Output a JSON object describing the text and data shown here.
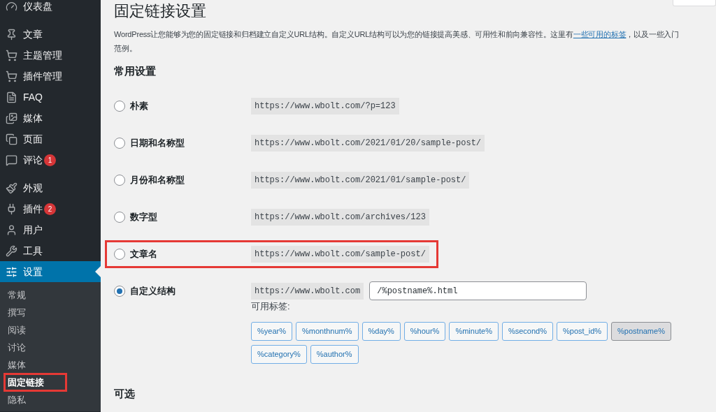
{
  "sidebar": {
    "items": [
      {
        "label": "仪表盘",
        "selected": false
      },
      {
        "label": "文章",
        "selected": false
      },
      {
        "label": "主题管理",
        "selected": false
      },
      {
        "label": "插件管理",
        "selected": false
      },
      {
        "label": "FAQ",
        "selected": false
      },
      {
        "label": "媒体",
        "selected": false
      },
      {
        "label": "页面",
        "selected": false
      },
      {
        "label": "评论",
        "selected": false,
        "badge": "1"
      },
      {
        "label": "外观",
        "selected": false
      },
      {
        "label": "插件",
        "selected": false,
        "badge": "2"
      },
      {
        "label": "用户",
        "selected": false
      },
      {
        "label": "工具",
        "selected": false
      },
      {
        "label": "设置",
        "selected": true,
        "submenu": [
          {
            "label": "常规",
            "selected": false,
            "highlighted": false
          },
          {
            "label": "撰写",
            "selected": false,
            "highlighted": false
          },
          {
            "label": "阅读",
            "selected": false,
            "highlighted": false
          },
          {
            "label": "讨论",
            "selected": false,
            "highlighted": false
          },
          {
            "label": "媒体",
            "selected": false,
            "highlighted": false
          },
          {
            "label": "固定链接",
            "selected": true,
            "highlighted": true
          },
          {
            "label": "隐私",
            "selected": false,
            "highlighted": false
          }
        ]
      }
    ]
  },
  "main": {
    "title": "固定链接设置",
    "intro": {
      "before": "WordPress让您能够为您的固定链接和归档建立自定义URL结构。自定义URL结构可以为您的链接提高美感、可用性和前向兼容性。这里有",
      "link": "一些可用的标签",
      "after": "，以及一些入门",
      "line2": "范例。"
    },
    "common_heading": "常用设置",
    "options": [
      {
        "kind": "preset",
        "label": "朴素",
        "url": "https://www.wbolt.com/?p=123",
        "selected": false,
        "highlighted": false
      },
      {
        "kind": "preset",
        "label": "日期和名称型",
        "url": "https://www.wbolt.com/2021/01/20/sample-post/",
        "selected": false,
        "highlighted": false
      },
      {
        "kind": "preset",
        "label": "月份和名称型",
        "url": "https://www.wbolt.com/2021/01/sample-post/",
        "selected": false,
        "highlighted": false
      },
      {
        "kind": "preset",
        "label": "数字型",
        "url": "https://www.wbolt.com/archives/123",
        "selected": false,
        "highlighted": false
      },
      {
        "kind": "preset",
        "label": "文章名",
        "url": "https://www.wbolt.com/sample-post/",
        "selected": false,
        "highlighted": true
      },
      {
        "kind": "custom",
        "label": "自定义结构",
        "url": "https://www.wbolt.com",
        "value": "/%postname%.html",
        "selected": true,
        "highlighted": false
      }
    ],
    "tags_label": "可用标签:",
    "tags": [
      {
        "label": "%year%",
        "selected": false
      },
      {
        "label": "%monthnum%",
        "selected": false
      },
      {
        "label": "%day%",
        "selected": false
      },
      {
        "label": "%hour%",
        "selected": false
      },
      {
        "label": "%minute%",
        "selected": false
      },
      {
        "label": "%second%",
        "selected": false
      },
      {
        "label": "%post_id%",
        "selected": false
      },
      {
        "label": "%postname%",
        "selected": true
      },
      {
        "label": "%category%",
        "selected": false
      },
      {
        "label": "%author%",
        "selected": false
      }
    ],
    "optional_heading": "可选"
  }
}
